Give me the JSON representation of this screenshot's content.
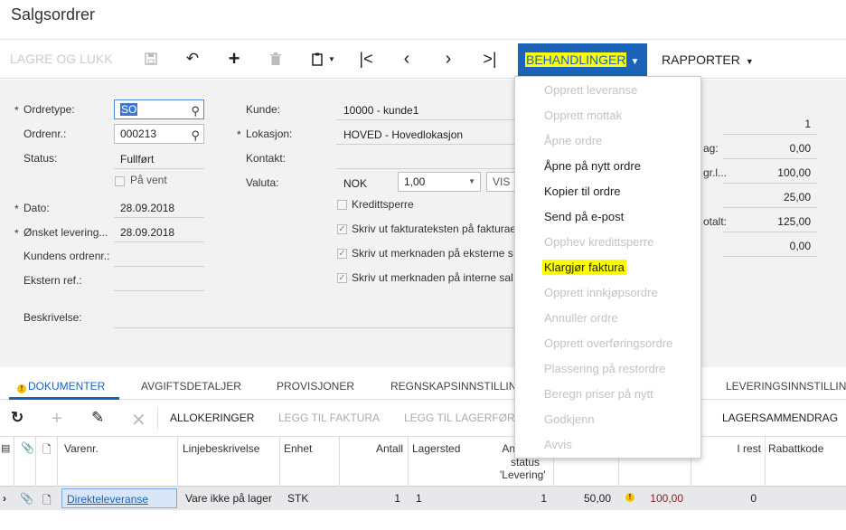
{
  "page": {
    "title": "Salgsordrer"
  },
  "toolbar": {
    "save_close": "LAGRE OG LUKK",
    "behandlinger": "BEHANDLINGER",
    "rapporter": "RAPPORTER"
  },
  "form": {
    "ordretype_label": "Ordretype:",
    "ordretype_value": "SO",
    "ordrenr_label": "Ordrenr.:",
    "ordrenr_value": "000213",
    "status_label": "Status:",
    "status_value": "Fullført",
    "paa_vent_label": "På vent",
    "dato_label": "Dato:",
    "dato_value": "28.09.2018",
    "onsket_label": "Ønsket levering...",
    "onsket_value": "28.09.2018",
    "kundens_label": "Kundens ordrenr.:",
    "ekstern_label": "Ekstern ref.:",
    "beskrivelse_label": "Beskrivelse:",
    "kunde_label": "Kunde:",
    "kunde_value": "10000 - kunde1",
    "lokasjon_label": "Lokasjon:",
    "lokasjon_value": "HOVED - Hovedlokasjon",
    "kontakt_label": "Kontakt:",
    "valuta_label": "Valuta:",
    "valuta_value": "NOK",
    "kurs_value": "1,00",
    "vis_label": "VIS",
    "kredittsperre_label": "Kredittsperre",
    "skriv1_label": "Skriv ut fakturateksten på fakturae",
    "skriv2_label": "Skriv ut merknaden på eksterne s",
    "skriv3_label": "Skriv ut merknaden på interne sal",
    "right_labels": [
      "ag:",
      "gr.l...",
      "otalt:"
    ],
    "right_values": [
      "1",
      "0,00",
      "100,00",
      "25,00",
      "125,00",
      "0,00"
    ]
  },
  "tabs": [
    "DOKUMENTER",
    "AVGIFTSDETALJER",
    "PROVISJONER",
    "REGNSKAPSINNSTILLIN",
    "LEVERINGSINNSTILLIN"
  ],
  "grid_toolbar": {
    "allokeringer": "ALLOKERINGER",
    "legg_faktura": "LEGG TIL FAKTURA",
    "legg_lager": "LEGG TIL LAGERFØR",
    "lagersammendrag": "LAGERSAMMENDRAG"
  },
  "grid": {
    "headers": {
      "varenr": "Varenr.",
      "linjebeskrivelse": "Linjebeskrivelse",
      "enhet": "Enhet",
      "antall": "Antall",
      "lagersted": "Lagersted",
      "an": "An",
      "status1": "status",
      "status2": "'Levering'",
      "i_rest": "I rest",
      "rabattkode": "Rabattkode"
    },
    "row": {
      "varenr": "Direkteleveranse",
      "linjebeskrivelse": "Vare ikke på lager",
      "enhet": "STK",
      "antall": "1",
      "lagersted": "1",
      "an": "1",
      "pris": "50,00",
      "belop": "100,00",
      "i_rest": "0"
    }
  },
  "dropdown": {
    "items": [
      "Opprett leveranse",
      "Opprett mottak",
      "Åpne ordre",
      "Åpne på nytt ordre",
      "Kopier til ordre",
      "Send på e-post",
      "Opphev kredittsperre",
      "Klargjør faktura",
      "Opprett innkjøpsordre",
      "Annuller ordre",
      "Opprett overføringsordre",
      "Plassering på restordre",
      "Beregn priser på nytt",
      "Godkjenn",
      "Avvis"
    ]
  },
  "colors": {
    "accent": "#1a63b8",
    "highlight": "#ffff00",
    "warning": "#f5c400"
  }
}
